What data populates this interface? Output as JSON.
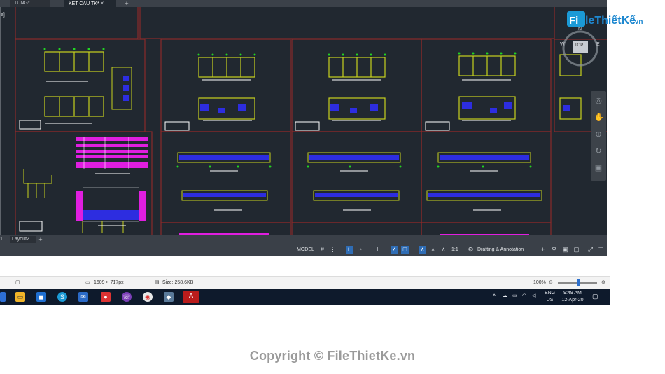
{
  "doc_tabs": [
    {
      "label": "TUNG*"
    },
    {
      "label": "KET CAU TK*"
    }
  ],
  "doc_tab_close": "×",
  "new_tab": "+",
  "viewcube": {
    "top": "TOP",
    "north": "N",
    "west": "W",
    "east": "E"
  },
  "layout_tabs": [
    {
      "label": "1"
    },
    {
      "label": "Layout2"
    }
  ],
  "status": {
    "model": "MODEL",
    "scale": "1:1",
    "workspace": "Drafting & Annotation"
  },
  "viewer": {
    "dimensions": "1609 × 717px",
    "size": "Size: 258.6KB",
    "zoom": "100%"
  },
  "tray": {
    "lang_top": "ENG",
    "lang_bottom": "US",
    "time": "9:49 AM",
    "date": "12-Apr-20"
  },
  "watermark": {
    "brand": "FileThiếtKế",
    "brand_suffix": ".vn",
    "copyright": "Copyright © FileThietKe.vn"
  },
  "colors": {
    "canvas": "#212830",
    "frame": "#8b2a2a",
    "wall": "#c8d21e",
    "rebar": "#2d2de0",
    "section": "#e01ee0",
    "accent": "#2f6db5"
  }
}
